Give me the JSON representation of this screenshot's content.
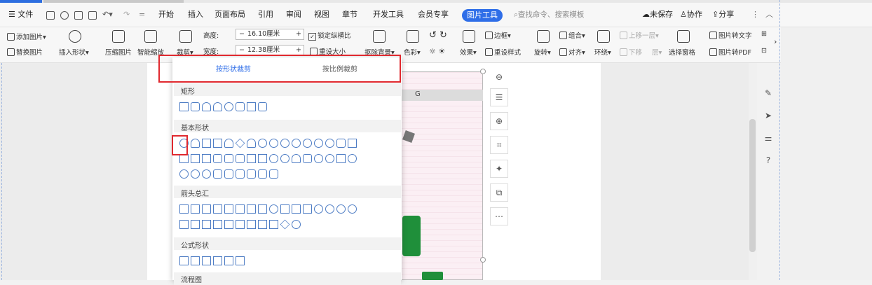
{
  "menu": {
    "file": "文件",
    "tabs": [
      "开始",
      "插入",
      "页面布局",
      "引用",
      "审阅",
      "视图",
      "章节",
      "开发工具",
      "会员专享"
    ],
    "active_tab": "图片工具",
    "search_placeholder": "查找命令、搜索模板",
    "right": [
      "未保存",
      "协作",
      "分享"
    ]
  },
  "ribbon": {
    "add_image": "添加图片",
    "replace_image": "替换图片",
    "insert_shape": "插入形状",
    "compress": "压缩图片",
    "smart_scale": "智能缩放",
    "crop": "裁剪",
    "height_label": "高度:",
    "height_value": "16.10厘米",
    "width_label": "宽度:",
    "width_value": "12.38厘米",
    "lock_ratio": "锁定纵横比",
    "reset_size": "重设大小",
    "remove_bg": "抠除背景",
    "color": "色彩",
    "effect": "效果",
    "border": "边框",
    "reset_style": "重设样式",
    "rotate": "旋转",
    "group": "组合",
    "align": "对齐",
    "wrap": "环绕",
    "bring_forward": "上移一层",
    "send_backward": "下移",
    "layer": "层",
    "selection_pane": "选择窗格",
    "img_to_text": "图片转文字",
    "img_to_pdf": "图片转PDF"
  },
  "crop_panel": {
    "tab_shape": "按形状裁剪",
    "tab_ratio": "按比例裁剪",
    "sections": [
      "矩形",
      "基本形状",
      "箭头总汇",
      "公式形状",
      "流程图"
    ]
  },
  "image": {
    "column_letter": "G"
  },
  "colors": {
    "accent": "#2f6ee8",
    "highlight": "#e0292f",
    "shape_stroke": "#4d7cc4"
  }
}
